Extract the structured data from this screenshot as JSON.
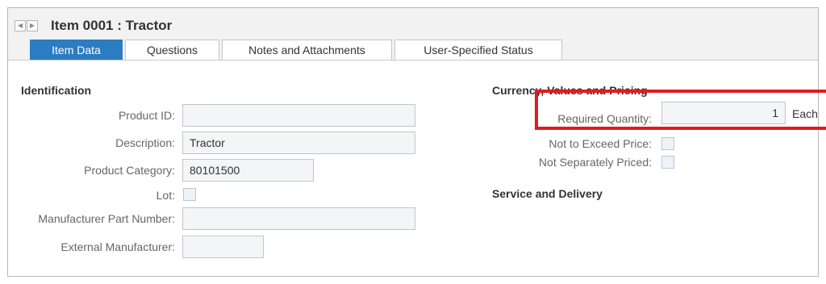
{
  "header": {
    "title": "Item 0001 : Tractor",
    "prev_icon": "chevron-left-icon",
    "next_icon": "chevron-right-icon"
  },
  "tabs": [
    {
      "label": "Item Data",
      "active": true
    },
    {
      "label": "Questions",
      "active": false
    },
    {
      "label": "Notes and Attachments",
      "active": false
    },
    {
      "label": "User-Specified Status",
      "active": false
    }
  ],
  "identification": {
    "title": "Identification",
    "product_id": {
      "label": "Product ID:",
      "value": ""
    },
    "description": {
      "label": "Description:",
      "value": "Tractor"
    },
    "product_category": {
      "label": "Product Category:",
      "value": "80101500"
    },
    "lot": {
      "label": "Lot:",
      "checked": false
    },
    "manufacturer_part_number": {
      "label": "Manufacturer Part Number:",
      "value": ""
    },
    "external_manufacturer": {
      "label": "External Manufacturer:",
      "value": ""
    }
  },
  "pricing": {
    "title": "Currency, Values and Pricing",
    "required_quantity": {
      "label": "Required Quantity:",
      "value": "1",
      "unit": "Each"
    },
    "not_to_exceed_price": {
      "label": "Not to Exceed Price:",
      "checked": false
    },
    "not_separately_priced": {
      "label": "Not Separately Priced:",
      "checked": false
    }
  },
  "service": {
    "title": "Service and Delivery"
  },
  "colors": {
    "active_tab": "#2b7cc0",
    "highlight": "#e11b22"
  }
}
